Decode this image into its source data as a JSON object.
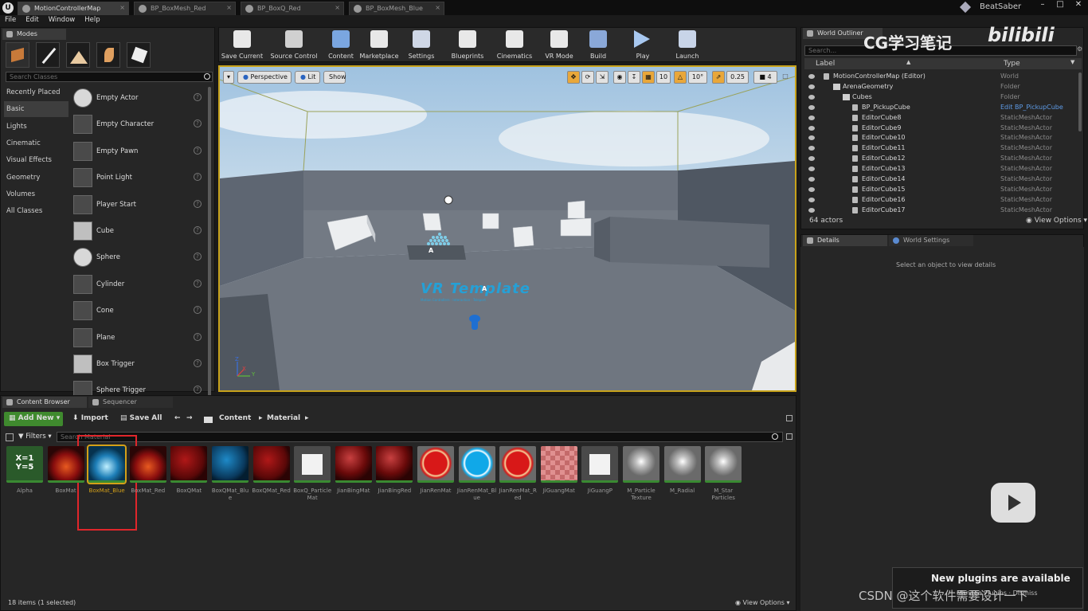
{
  "tabs": [
    {
      "label": "MotionControllerMap",
      "active": true
    },
    {
      "label": "BP_BoxMesh_Red",
      "active": false
    },
    {
      "label": "BP_BoxQ_Red",
      "active": false
    },
    {
      "label": "BP_BoxMesh_Blue",
      "active": false
    }
  ],
  "project": "BeatSaber",
  "menu": [
    "File",
    "Edit",
    "Window",
    "Help"
  ],
  "modes": {
    "title": "Modes",
    "search_placeholder": "Search Classes",
    "categories": [
      "Recently Placed",
      "Basic",
      "Lights",
      "Cinematic",
      "Visual Effects",
      "Geometry",
      "Volumes",
      "All Classes"
    ],
    "selected_category": "Basic",
    "items": [
      "Empty Actor",
      "Empty Character",
      "Empty Pawn",
      "Point Light",
      "Player Start",
      "Cube",
      "Sphere",
      "Cylinder",
      "Cone",
      "Plane",
      "Box Trigger",
      "Sphere Trigger"
    ]
  },
  "toolbar": [
    "Save Current",
    "Source Control",
    "Content",
    "Marketplace",
    "Settings",
    "Blueprints",
    "Cinematics",
    "VR Mode",
    "Build",
    "Play",
    "Launch"
  ],
  "viewport": {
    "perspective": "Perspective",
    "lit": "Lit",
    "show": "Show",
    "grid": "10",
    "rotation": "10°",
    "scale": "0.25",
    "camera_speed": "4",
    "text_label": "VR Template",
    "text_sub": "Motion Controllers · Interaction · Teleport",
    "axis_x": "X",
    "axis_y": "Y",
    "axis_z": "Z",
    "player_label": "A"
  },
  "outliner": {
    "title": "World Outliner",
    "search_placeholder": "Search...",
    "col_label": "Label",
    "col_type": "Type",
    "rows": [
      {
        "label": "MotionControllerMap (Editor)",
        "type": "World",
        "indent": 0
      },
      {
        "label": "ArenaGeometry",
        "type": "Folder",
        "indent": 1
      },
      {
        "label": "Cubes",
        "type": "Folder",
        "indent": 2
      },
      {
        "label": "BP_PickupCube",
        "type": "Edit BP_PickupCube",
        "indent": 3
      },
      {
        "label": "EditorCube8",
        "type": "StaticMeshActor",
        "indent": 3
      },
      {
        "label": "EditorCube9",
        "type": "StaticMeshActor",
        "indent": 3
      },
      {
        "label": "EditorCube10",
        "type": "StaticMeshActor",
        "indent": 3
      },
      {
        "label": "EditorCube11",
        "type": "StaticMeshActor",
        "indent": 3
      },
      {
        "label": "EditorCube12",
        "type": "StaticMeshActor",
        "indent": 3
      },
      {
        "label": "EditorCube13",
        "type": "StaticMeshActor",
        "indent": 3
      },
      {
        "label": "EditorCube14",
        "type": "StaticMeshActor",
        "indent": 3
      },
      {
        "label": "EditorCube15",
        "type": "StaticMeshActor",
        "indent": 3
      },
      {
        "label": "EditorCube16",
        "type": "StaticMeshActor",
        "indent": 3
      },
      {
        "label": "EditorCube17",
        "type": "StaticMeshActor",
        "indent": 3
      }
    ],
    "actor_count": "64 actors",
    "view_options": "View Options"
  },
  "details": {
    "tab1": "Details",
    "tab2": "World Settings",
    "empty_msg": "Select an object to view details"
  },
  "content_browser": {
    "tab1": "Content Browser",
    "tab2": "Sequencer",
    "add_new": "Add New",
    "import": "Import",
    "save_all": "Save All",
    "path": [
      "Content",
      "Material"
    ],
    "filters": "Filters",
    "search_placeholder": "Search Material",
    "assets": [
      {
        "name": "Alpha",
        "kind": "func"
      },
      {
        "name": "BoxMat",
        "kind": "red"
      },
      {
        "name": "BoxMat_Blue",
        "kind": "blue",
        "selected": true
      },
      {
        "name": "BoxMat_Red",
        "kind": "red"
      },
      {
        "name": "BoxQMat",
        "kind": "red2"
      },
      {
        "name": "BoxQMat_Blue",
        "kind": "blue2"
      },
      {
        "name": "BoxQMat_Red",
        "kind": "red2"
      },
      {
        "name": "BoxQ_ParticleMat",
        "kind": "white"
      },
      {
        "name": "JianBingMat",
        "kind": "dark"
      },
      {
        "name": "JianBingRed",
        "kind": "dark"
      },
      {
        "name": "JianRenMat",
        "kind": "ringred"
      },
      {
        "name": "JianRenMat_Blue",
        "kind": "ringblue"
      },
      {
        "name": "JianRenMat_Red",
        "kind": "ringred"
      },
      {
        "name": "JiGuangMat",
        "kind": "checker"
      },
      {
        "name": "JiGuangP",
        "kind": "white"
      },
      {
        "name": "M_Particle Texture",
        "kind": "glow"
      },
      {
        "name": "M_Radial",
        "kind": "glow"
      },
      {
        "name": "M_Star Particles",
        "kind": "glow"
      }
    ],
    "func_text": "X=1\nY=5",
    "status": "18 items (1 selected)",
    "view_options": "View Options"
  },
  "overlays": {
    "watermark": "CG学习笔记",
    "plugins_notice": "New plugins are available",
    "plugins_sub": "Manage Plugins · Dismiss",
    "csdn": "CSDN @这个软件需要设计一下"
  }
}
